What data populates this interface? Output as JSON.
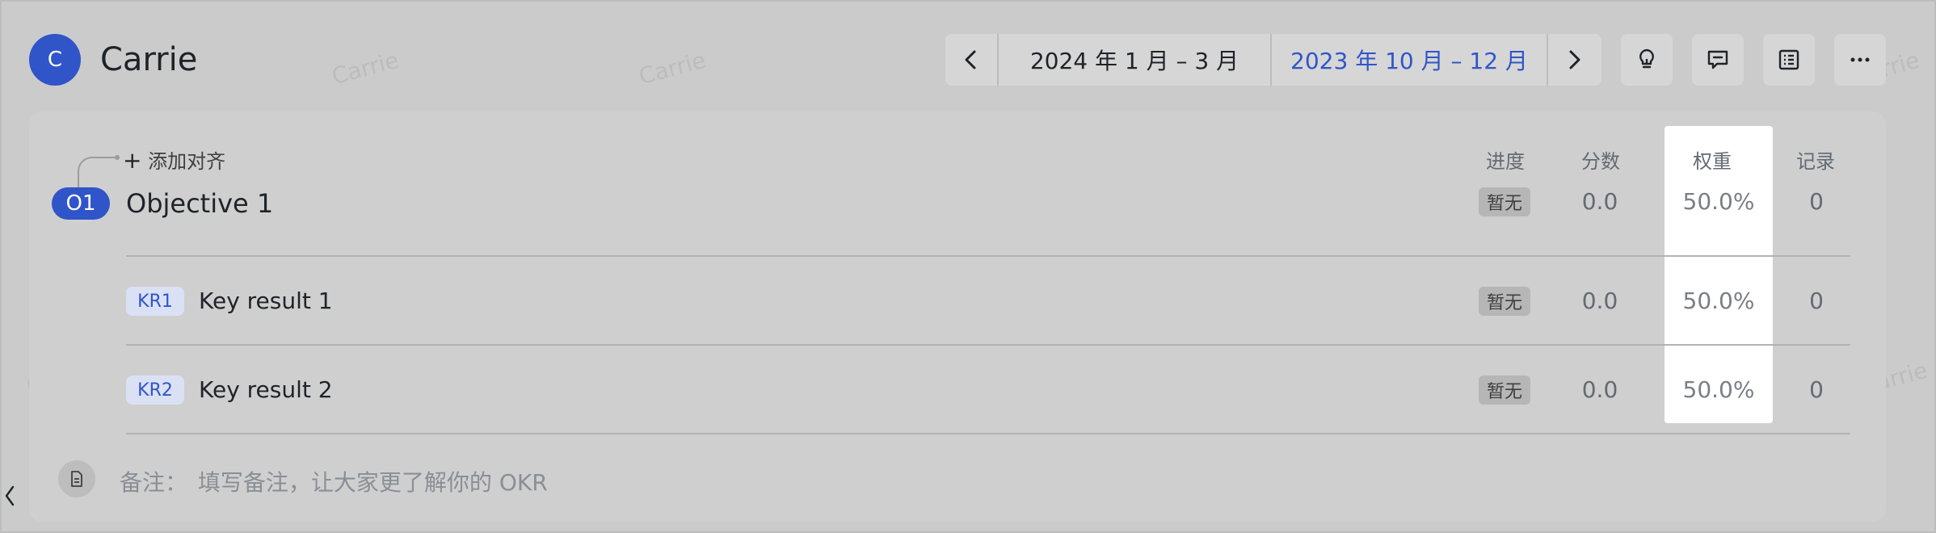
{
  "user": {
    "avatar_letter": "C",
    "name": "Carrie"
  },
  "period": {
    "current": "2024 年 1 月 – 3 月",
    "selected": "2023 年 10 月 – 12 月"
  },
  "toolbar": {
    "icons": [
      "lightbulb-icon",
      "comment-icon",
      "list-icon",
      "more-icon"
    ]
  },
  "columns": {
    "progress": "进度",
    "score": "分数",
    "weight": "权重",
    "records": "记录"
  },
  "add_alignment": "添加对齐",
  "objective": {
    "badge": "O1",
    "title": "Objective 1",
    "progress": "暂无",
    "score": "0.0",
    "weight": "50.0%",
    "records": "0"
  },
  "key_results": [
    {
      "badge": "KR1",
      "title": "Key result 1",
      "progress": "暂无",
      "score": "0.0",
      "weight": "50.0%",
      "records": "0"
    },
    {
      "badge": "KR2",
      "title": "Key result 2",
      "progress": "暂无",
      "score": "0.0",
      "weight": "50.0%",
      "records": "0"
    }
  ],
  "note": {
    "label": "备注：",
    "placeholder": "填写备注，让大家更了解你的 OKR"
  },
  "watermark": "Carrie",
  "colors": {
    "accent": "#2f55c9",
    "overlay": "#cbcbcb"
  }
}
